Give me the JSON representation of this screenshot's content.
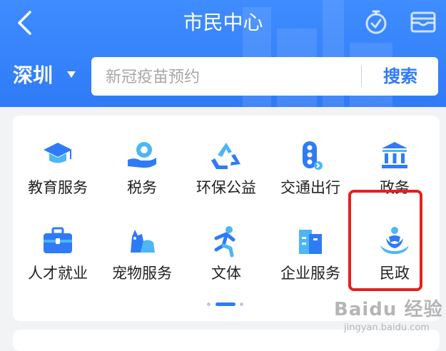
{
  "header": {
    "title": "市民中心",
    "back_icon": "chevron-left-icon",
    "right_icons": [
      "stopwatch-icon",
      "wallet-icon"
    ]
  },
  "search": {
    "city": "深圳",
    "placeholder": "新冠疫苗预约",
    "button_label": "搜索"
  },
  "services": [
    {
      "label": "教育服务",
      "icon": "graduation-cap-icon"
    },
    {
      "label": "税务",
      "icon": "tax-hand-coin-icon"
    },
    {
      "label": "环保公益",
      "icon": "recycle-icon"
    },
    {
      "label": "交通出行",
      "icon": "traffic-light-icon"
    },
    {
      "label": "政务",
      "icon": "government-building-icon"
    },
    {
      "label": "人才就业",
      "icon": "briefcase-icon"
    },
    {
      "label": "宠物服务",
      "icon": "pet-icon"
    },
    {
      "label": "文体",
      "icon": "running-person-icon"
    },
    {
      "label": "企业服务",
      "icon": "office-building-icon"
    },
    {
      "label": "民政",
      "icon": "civil-affairs-icon"
    }
  ],
  "pager": {
    "pages": 3,
    "active": 1
  },
  "watermark": {
    "main": "Baidu 经验",
    "sub": "jingyan.baidu.com"
  },
  "colors": {
    "brand_blue": "#2f7bf7",
    "highlight_red": "#e4211c",
    "icon_light_blue": "#4db6f4"
  }
}
